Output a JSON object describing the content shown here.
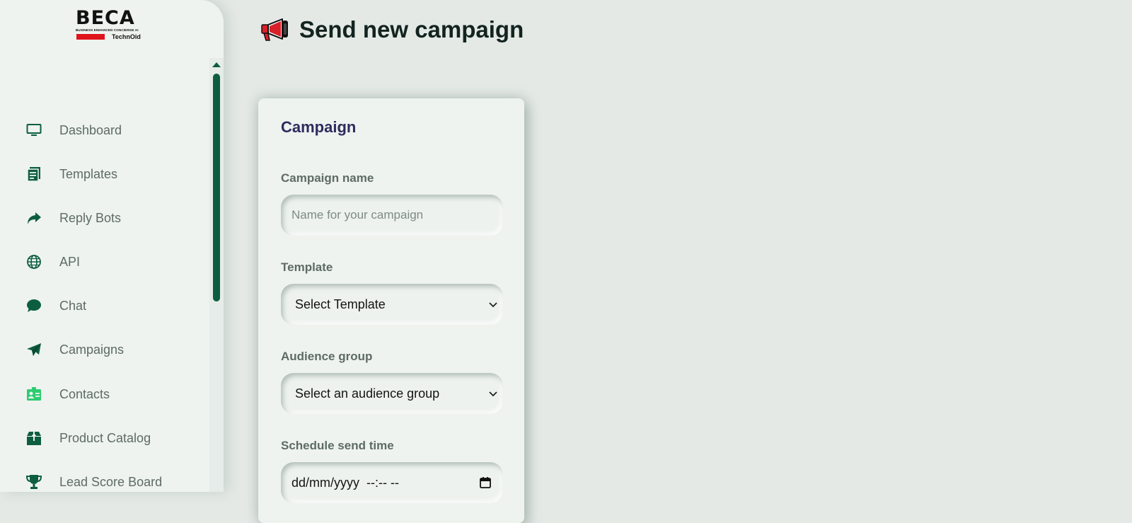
{
  "brand": {
    "logo_text": "BECA",
    "logo_subtitle": "BUSINESS ENHANCED CONCIERGE AI",
    "logo_tech": "TechnOid"
  },
  "sidebar": {
    "items": [
      {
        "label": "Dashboard",
        "icon": "monitor-icon"
      },
      {
        "label": "Templates",
        "icon": "document-icon"
      },
      {
        "label": "Reply Bots",
        "icon": "share-arrow-icon"
      },
      {
        "label": "API",
        "icon": "globe-icon"
      },
      {
        "label": "Chat",
        "icon": "chat-bubble-icon"
      },
      {
        "label": "Campaigns",
        "icon": "paper-plane-icon"
      },
      {
        "label": "Contacts",
        "icon": "contact-card-icon"
      },
      {
        "label": "Product Catalog",
        "icon": "box-icon"
      },
      {
        "label": "Lead Score Board",
        "icon": "trophy-icon"
      }
    ]
  },
  "page": {
    "title": "Send new campaign",
    "title_icon": "megaphone-icon"
  },
  "form": {
    "card_title": "Campaign",
    "campaign_name": {
      "label": "Campaign name",
      "placeholder": "Name for your campaign",
      "value": ""
    },
    "template": {
      "label": "Template",
      "value": "Select Template"
    },
    "audience": {
      "label": "Audience group",
      "value": "Select an audience group"
    },
    "schedule": {
      "label": "Schedule send time",
      "value": "dd/mm/yyyy  --:-- --"
    }
  },
  "colors": {
    "brand_green": "#0d5e40",
    "contacts_green": "#2ecc71",
    "card_title": "#2e2b5e",
    "logo_red": "#e0141b",
    "megaphone_red": "#d8202a"
  }
}
